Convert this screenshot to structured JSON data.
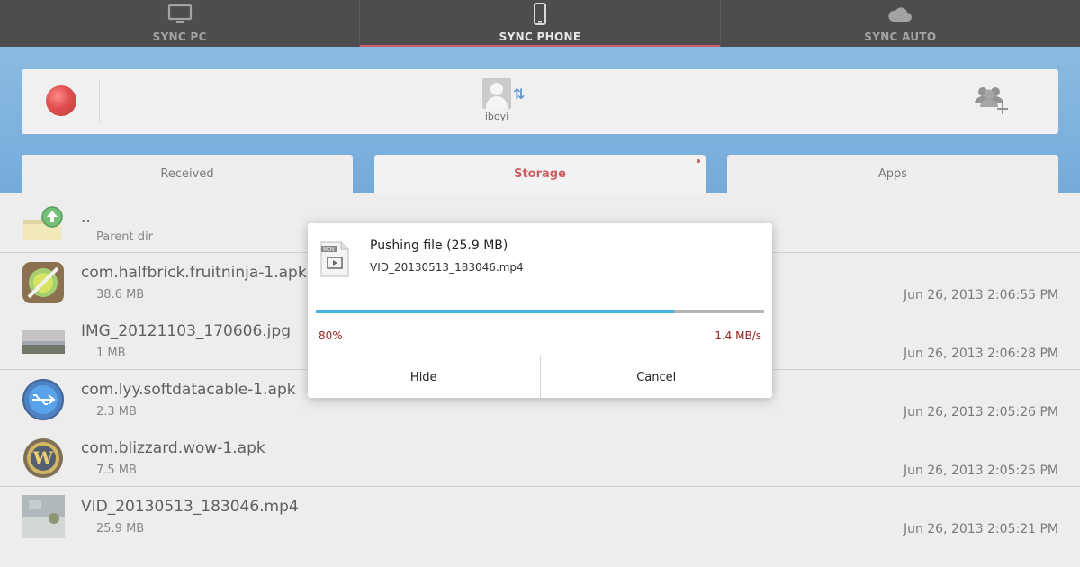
{
  "top_tabs": [
    {
      "label": "SYNC PC",
      "icon": "monitor-icon",
      "active": false
    },
    {
      "label": "SYNC PHONE",
      "icon": "phone-icon",
      "active": true
    },
    {
      "label": "SYNC AUTO",
      "icon": "cloud-icon",
      "active": false
    }
  ],
  "device": {
    "name": "iboyi",
    "status_icon": "red-record-icon",
    "add_icon": "add-people-icon"
  },
  "sub_tabs": [
    {
      "label": "Received",
      "active": false
    },
    {
      "label": "Storage",
      "active": true
    },
    {
      "label": "Apps",
      "active": false
    }
  ],
  "parent": {
    "name": "..",
    "label": "Parent dir",
    "icon": "parent-folder-icon"
  },
  "files": [
    {
      "name": "com.halfbrick.fruitninja-1.apk",
      "size": "38.6 MB",
      "date": "Jun 26, 2013 2:06:55 PM",
      "icon": "fruit-ninja-icon"
    },
    {
      "name": "IMG_20121103_170606.jpg",
      "size": "1 MB",
      "date": "Jun 26, 2013 2:06:28 PM",
      "icon": "photo-thumbnail"
    },
    {
      "name": "com.lyy.softdatacable-1.apk",
      "size": "2.3 MB",
      "date": "Jun 26, 2013 2:05:26 PM",
      "icon": "usb-app-icon"
    },
    {
      "name": "com.blizzard.wow-1.apk",
      "size": "7.5 MB",
      "date": "Jun 26, 2013 2:05:25 PM",
      "icon": "wow-icon"
    },
    {
      "name": "VID_20130513_183046.mp4",
      "size": "25.9 MB",
      "date": "Jun 26, 2013 2:05:21 PM",
      "icon": "video-thumbnail"
    }
  ],
  "dialog": {
    "title": "Pushing file (25.9 MB)",
    "filename": "VID_20130513_183046.mp4",
    "file_icon_label": "MOV",
    "progress": 0.8,
    "percent_label": "80%",
    "speed": "1.4 MB/s",
    "hide_label": "Hide",
    "cancel_label": "Cancel"
  },
  "colors": {
    "accent_red": "#c0313b",
    "progress_blue": "#45b5e0",
    "header_blue": "#4f93cf"
  }
}
